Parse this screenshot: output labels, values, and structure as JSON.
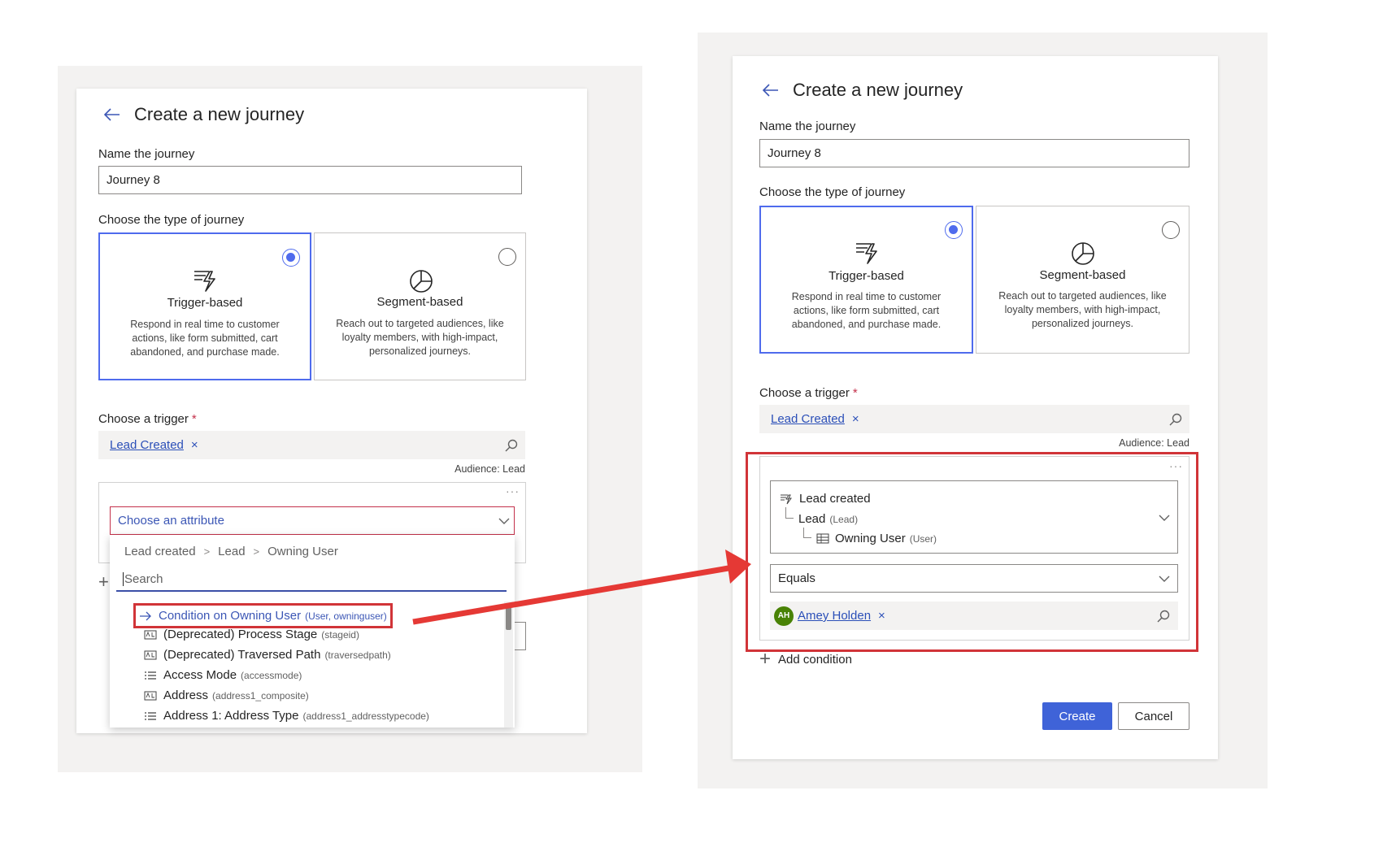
{
  "left": {
    "title": "Create a new journey",
    "name_label": "Name the journey",
    "name_value": "Journey 8",
    "type_label": "Choose the type of journey",
    "types": [
      {
        "title": "Trigger-based",
        "desc": "Respond in real time to customer actions, like form submitted, cart abandoned, and purchase made.",
        "selected": true
      },
      {
        "title": "Segment-based",
        "desc": "Reach out to targeted audiences, like loyalty members, with high-impact, personalized journeys.",
        "selected": false
      }
    ],
    "trigger_label": "Choose a trigger",
    "required_mark": "*",
    "trigger_tag": "Lead Created",
    "tag_remove": "×",
    "audience": "Audience: Lead",
    "more": "···",
    "attribute_placeholder": "Choose an attribute",
    "breadcrumb": [
      "Lead created",
      "Lead",
      "Owning User"
    ],
    "breadcrumb_sep": ">",
    "search_placeholder": "Search",
    "options": [
      {
        "label": "Condition on Owning User",
        "sub": "(User, owninguser)",
        "icon": "arrow-right-icon",
        "highlighted": true
      },
      {
        "label": "(Deprecated) Process Stage",
        "sub": "(stageid)",
        "icon": "text-field-icon"
      },
      {
        "label": "(Deprecated) Traversed Path",
        "sub": "(traversedpath)",
        "icon": "text-field-icon"
      },
      {
        "label": "Access Mode",
        "sub": "(accessmode)",
        "icon": "list-icon"
      },
      {
        "label": "Address",
        "sub": "(address1_composite)",
        "icon": "text-field-icon"
      },
      {
        "label": "Address 1: Address Type",
        "sub": "(address1_addresstypecode)",
        "icon": "list-icon"
      }
    ]
  },
  "right": {
    "title": "Create a new journey",
    "name_label": "Name the journey",
    "name_value": "Journey 8",
    "type_label": "Choose the type of journey",
    "types": [
      {
        "title": "Trigger-based",
        "desc": "Respond in real time to customer actions, like form submitted, cart abandoned, and purchase made.",
        "selected": true
      },
      {
        "title": "Segment-based",
        "desc": "Reach out to targeted audiences, like loyalty members, with high-impact, personalized journeys.",
        "selected": false
      }
    ],
    "trigger_label": "Choose a trigger",
    "required_mark": "*",
    "trigger_tag": "Lead Created",
    "tag_remove": "×",
    "audience": "Audience: Lead",
    "more": "···",
    "tree": {
      "root": "Lead created",
      "level1": "Lead",
      "level1_sub": "(Lead)",
      "level2": "Owning User",
      "level2_sub": "(User)"
    },
    "operator": "Equals",
    "value": {
      "initials": "AH",
      "name": "Amey Holden",
      "remove": "×"
    },
    "add_condition": "Add condition",
    "create_label": "Create",
    "cancel_label": "Cancel"
  },
  "colors": {
    "accent": "#4f6bed",
    "highlight_red": "#d13438",
    "primary_button": "#3f63d8",
    "avatar": "#498205"
  }
}
